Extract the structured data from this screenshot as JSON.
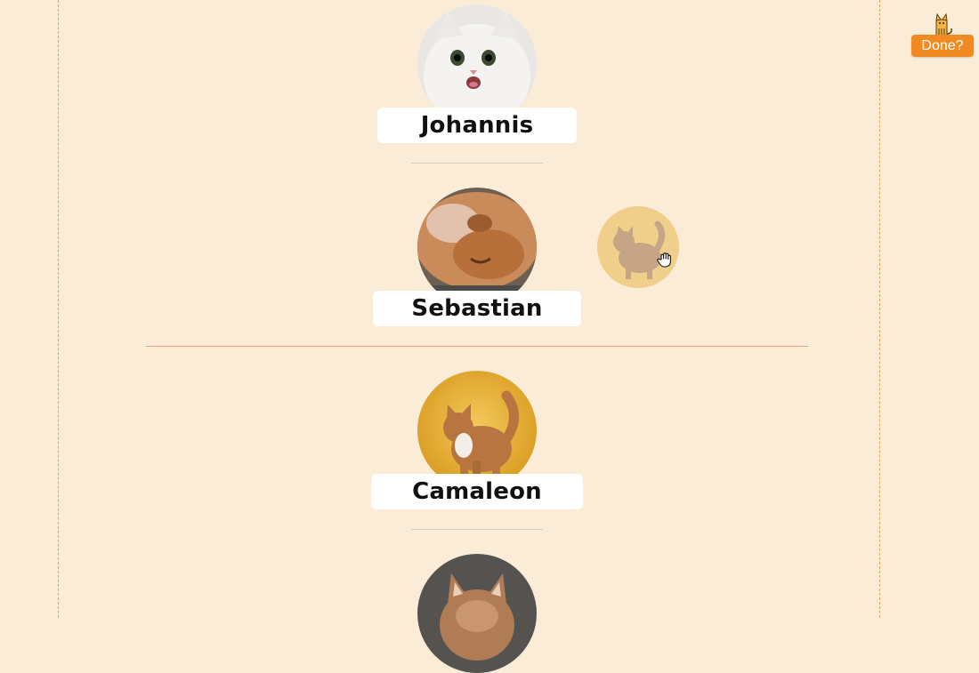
{
  "cats": [
    {
      "name": "Johannis",
      "photo_icon": "white-kitten-photo"
    },
    {
      "name": "Sebastian",
      "photo_icon": "fluffy-ginger-cat-photo"
    },
    {
      "name": "Camaleon",
      "photo_icon": "orange-tabby-yellow-bg-photo"
    },
    {
      "name": "",
      "photo_icon": "maine-coon-gray-bg-photo"
    }
  ],
  "drag": {
    "icon": "orange-tabby-drag-ghost",
    "cursor": "grab-hand-icon"
  },
  "done": {
    "label": "Done?",
    "icon": "cat-mascot-icon"
  },
  "colors": {
    "background": "#fbecd7",
    "accent": "#f18a22",
    "drop_line": "#ef9f7c"
  }
}
